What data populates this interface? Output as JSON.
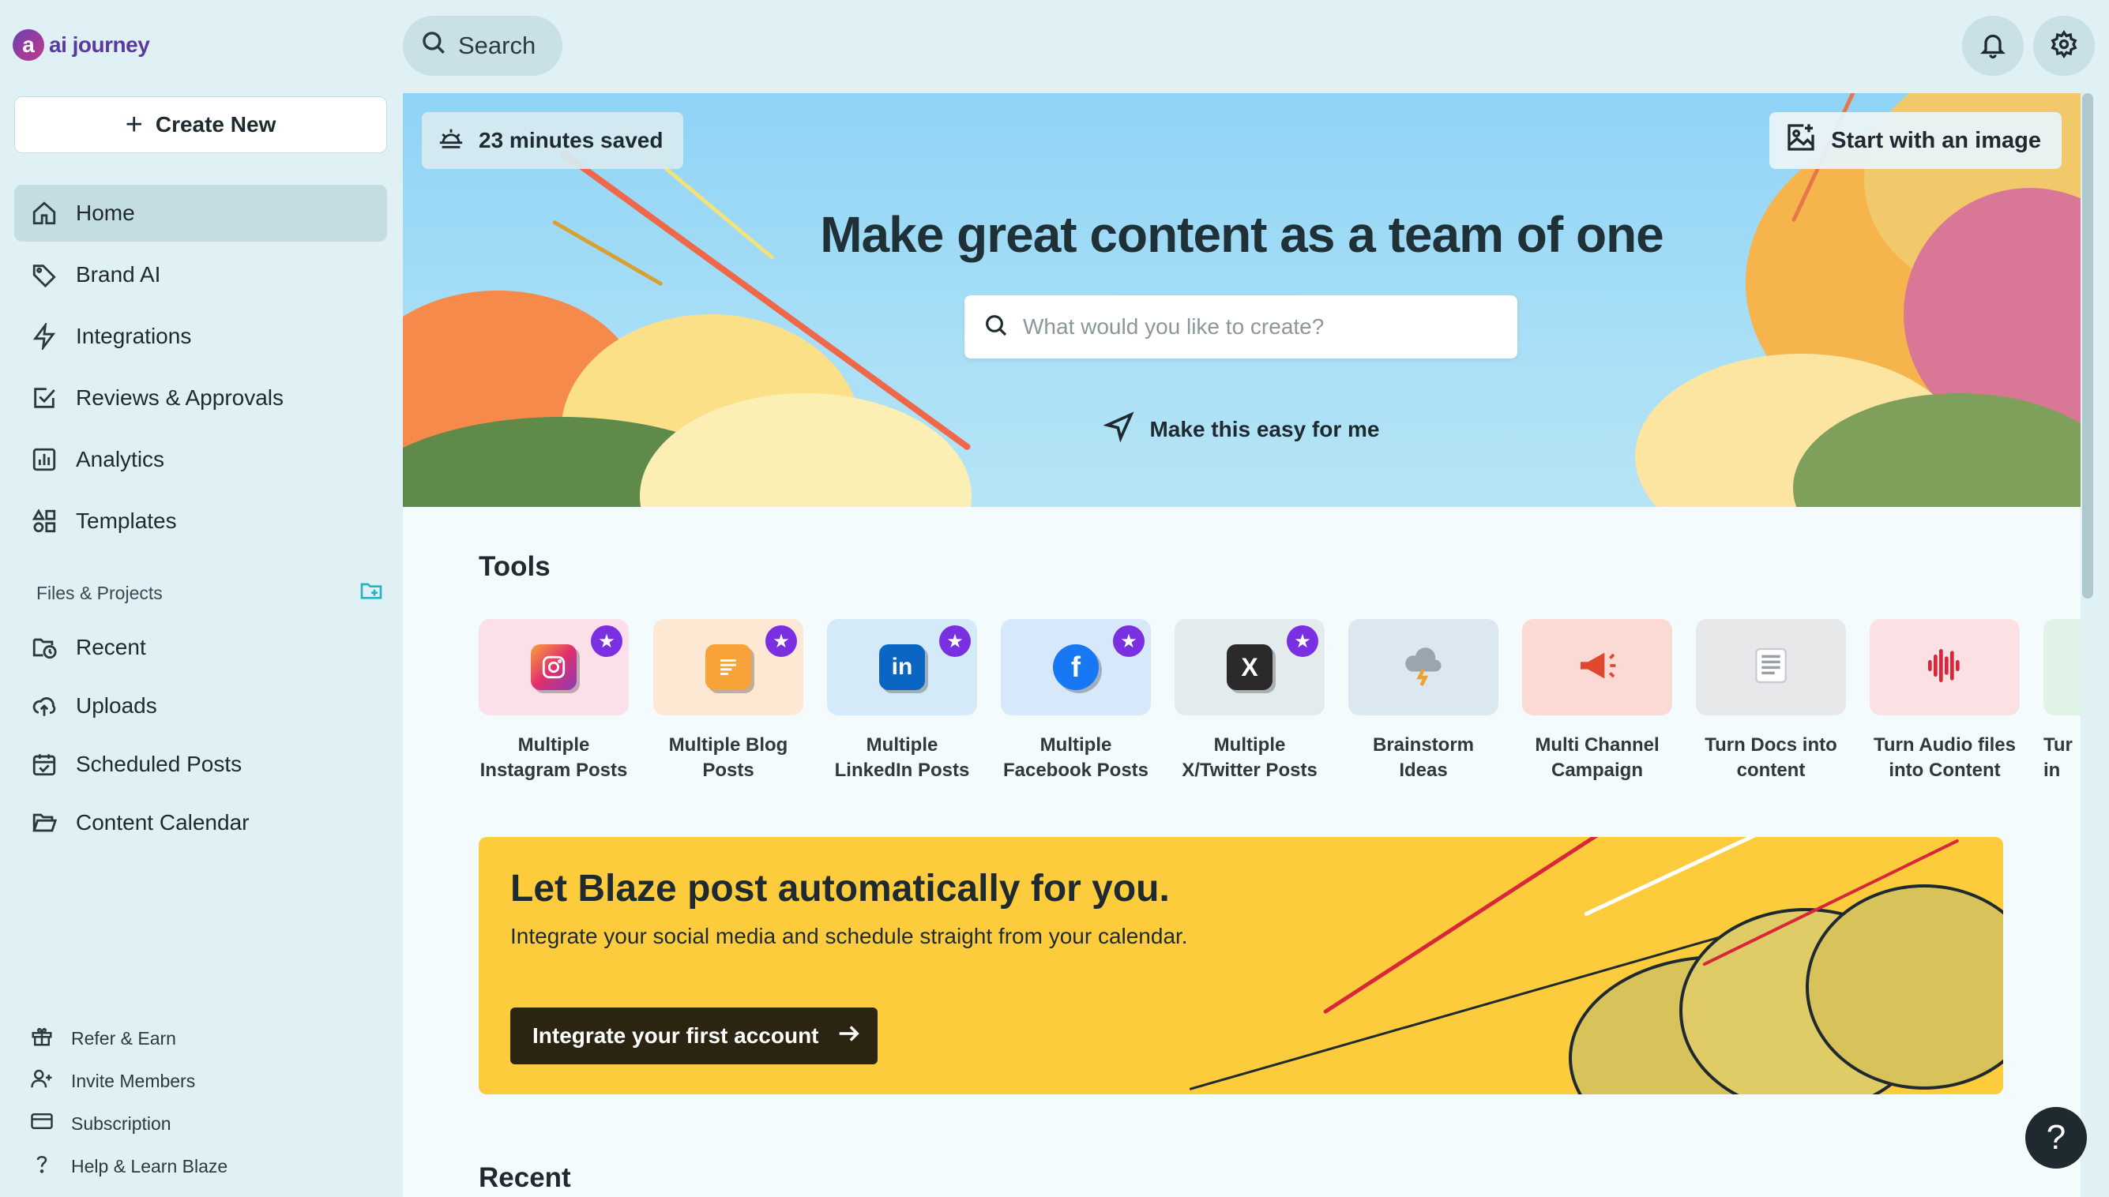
{
  "brand": {
    "name": "ai journey",
    "mark": "a"
  },
  "sidebar": {
    "create_label": "Create New",
    "nav": [
      {
        "label": "Home",
        "icon": "home-icon"
      },
      {
        "label": "Brand AI",
        "icon": "tag-icon"
      },
      {
        "label": "Integrations",
        "icon": "bolt-icon"
      },
      {
        "label": "Reviews & Approvals",
        "icon": "checkbox-icon"
      },
      {
        "label": "Analytics",
        "icon": "bar-chart-icon"
      },
      {
        "label": "Templates",
        "icon": "shapes-icon"
      }
    ],
    "files_heading": "Files & Projects",
    "files": [
      {
        "label": "Recent",
        "icon": "folder-clock-icon"
      },
      {
        "label": "Uploads",
        "icon": "cloud-upload-icon"
      },
      {
        "label": "Scheduled Posts",
        "icon": "calendar-check-icon"
      },
      {
        "label": "Content Calendar",
        "icon": "folder-open-icon"
      }
    ],
    "footer": [
      {
        "label": "Refer & Earn",
        "icon": "gift-icon"
      },
      {
        "label": "Invite Members",
        "icon": "user-plus-icon"
      },
      {
        "label": "Subscription",
        "icon": "credit-card-icon"
      },
      {
        "label": "Help & Learn Blaze",
        "icon": "question-icon"
      }
    ]
  },
  "topbar": {
    "search_label": "Search"
  },
  "hero": {
    "saved_text": "23 minutes saved",
    "start_image": "Start with an image",
    "title": "Make great content as a team of one",
    "search_placeholder": "What would you like to create?",
    "easy_link": "Make this easy for me"
  },
  "tools": {
    "title": "Tools",
    "items": [
      {
        "line1": "Multiple",
        "line2": "Instagram Posts",
        "starred": true,
        "bg": "#fbe0ea",
        "badge": "instagram"
      },
      {
        "line1": "Multiple Blog",
        "line2": "Posts",
        "starred": true,
        "bg": "#fde8d4",
        "badge": "blog"
      },
      {
        "line1": "Multiple",
        "line2": "LinkedIn Posts",
        "starred": true,
        "bg": "#d4eaf8",
        "badge": "in"
      },
      {
        "line1": "Multiple",
        "line2": "Facebook Posts",
        "starred": true,
        "bg": "#d8e8fb",
        "badge": "f"
      },
      {
        "line1": "Multiple",
        "line2": "X/Twitter Posts",
        "starred": true,
        "bg": "#e3ebee",
        "badge": "X"
      },
      {
        "line1": "Brainstorm",
        "line2": "Ideas",
        "starred": false,
        "bg": "#dce8f0",
        "badge": "cloud"
      },
      {
        "line1": "Multi Channel",
        "line2": "Campaign",
        "starred": false,
        "bg": "#fbd9d4",
        "badge": "megaphone"
      },
      {
        "line1": "Turn Docs into",
        "line2": "content",
        "starred": false,
        "bg": "#e6e8ea",
        "badge": "doc"
      },
      {
        "line1": "Turn Audio files",
        "line2": "into Content",
        "starred": false,
        "bg": "#fbe0e4",
        "badge": "audio"
      },
      {
        "line1": "Tur",
        "line2": "in",
        "starred": false,
        "bg": "#dff3e6",
        "badge": ""
      }
    ]
  },
  "blaze": {
    "title": "Let Blaze post automatically for you.",
    "subtitle": "Integrate your social media and schedule straight from your calendar.",
    "button": "Integrate your first account"
  },
  "recent": {
    "title": "Recent"
  },
  "help": {
    "label": "?"
  },
  "colors": {
    "accent": "#7a2fe0",
    "sidebar_bg": "#dff1f4",
    "banner": "#fccc3c"
  }
}
